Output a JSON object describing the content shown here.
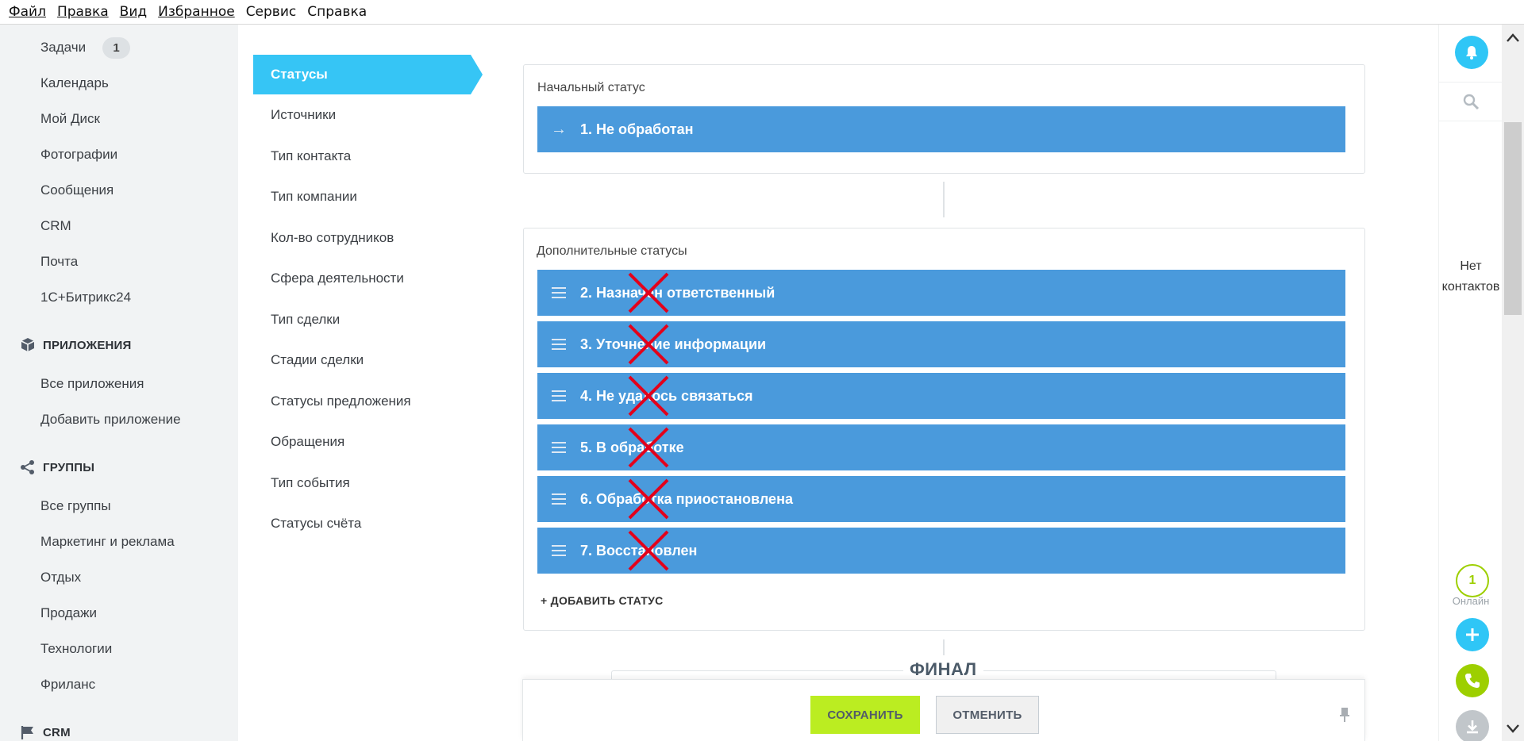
{
  "menubar": {
    "items": [
      {
        "label": "Файл"
      },
      {
        "label": "Правка"
      },
      {
        "label": "Вид"
      },
      {
        "label": "Избранное"
      },
      {
        "label": "Сервис"
      },
      {
        "label": "Справка"
      }
    ]
  },
  "sidebar": {
    "top_items": [
      {
        "label": "Задачи",
        "badge": "1"
      },
      {
        "label": "Календарь"
      },
      {
        "label": "Мой Диск"
      },
      {
        "label": "Фотографии"
      },
      {
        "label": "Сообщения"
      },
      {
        "label": "CRM"
      },
      {
        "label": "Почта"
      },
      {
        "label": "1С+Битрикс24"
      }
    ],
    "apps": {
      "heading": "ПРИЛОЖЕНИЯ",
      "icon": "box-icon",
      "items": [
        {
          "label": "Все приложения"
        },
        {
          "label": "Добавить приложение"
        }
      ]
    },
    "groups": {
      "heading": "ГРУППЫ",
      "icon": "share-icon",
      "items": [
        {
          "label": "Все группы"
        },
        {
          "label": "Маркетинг и реклама"
        },
        {
          "label": "Отдых"
        },
        {
          "label": "Продажи"
        },
        {
          "label": "Технологии"
        },
        {
          "label": "Фриланс"
        }
      ]
    },
    "crm": {
      "heading": "CRM",
      "icon": "flag-icon"
    }
  },
  "settings_menu": {
    "active": "Статусы",
    "items": [
      {
        "label": "Источники"
      },
      {
        "label": "Тип контакта"
      },
      {
        "label": "Тип компании"
      },
      {
        "label": "Кол-во сотрудников"
      },
      {
        "label": "Сфера деятельности"
      },
      {
        "label": "Тип сделки"
      },
      {
        "label": "Стадии сделки"
      },
      {
        "label": "Статусы предложения"
      },
      {
        "label": "Обращения"
      },
      {
        "label": "Тип события"
      },
      {
        "label": "Статусы счёта"
      }
    ]
  },
  "initial_status": {
    "title": "Начальный статус",
    "status": {
      "label": "1. Не обработан",
      "icon": "arrow-right-icon"
    }
  },
  "additional_statuses": {
    "title": "Дополнительные статусы",
    "items": [
      {
        "label": "2. Назначен ответственный"
      },
      {
        "label": "3. Уточнение информации"
      },
      {
        "label": "4. Не удалось связаться"
      },
      {
        "label": "5. В обработке"
      },
      {
        "label": "6. Обработка приостановлена"
      },
      {
        "label": "7. Восстановлен"
      }
    ],
    "add_label": "+ ДОБАВИТЬ СТАТУС",
    "status_color": "#4a9adc",
    "cross_color": "#e3001b"
  },
  "final": {
    "title": "ФИНАЛ"
  },
  "footer": {
    "save_label": "СОХРАНИТЬ",
    "cancel_label": "ОТМЕНИТЬ"
  },
  "rightbar": {
    "no_contacts_line1": "Нет",
    "no_contacts_line2": "контактов",
    "online_count": "1",
    "online_label": "Онлайн"
  },
  "colors": {
    "accent": "#36c5f5",
    "save_button": "#bbed21",
    "online_green": "#9dcf00"
  }
}
